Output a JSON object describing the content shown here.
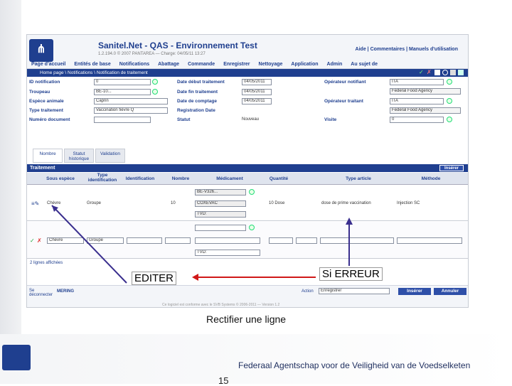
{
  "slide": {
    "caption": "Rectifier une ligne",
    "agency": "Federaal Agentschap voor de Veiligheid van de Voedselketen",
    "page_number": "15"
  },
  "app": {
    "title": "Sanitel.Net - QAS - Environnement Test",
    "subtitle": "1.2.194.0 © 2007 PANTAREA — Charge: 04/05/11 13:27",
    "top_links": "Aide | Commentaires | Manuels d'utilisation",
    "menu": [
      "Page d'accueil",
      "Entités de base",
      "Notifications",
      "Abattage",
      "Commande",
      "Enregistrer",
      "Nettoyage",
      "Application",
      "Admin",
      "Au sujet de"
    ],
    "breadcrumb": "Home page \\ Notifications \\ Notification de traitement"
  },
  "form": {
    "labels": {
      "id_notification": "ID notification",
      "troupeau": "Troupeau",
      "espece": "Espèce animale",
      "type_traitement": "Type traitement",
      "numero_document": "Numéro document",
      "date_debut": "Date début traitement",
      "date_fin": "Date fin traitement",
      "date_comptage": "Date de comptage",
      "registration_date": "Registration Date",
      "statut": "Statut",
      "operateur_notifiant": "Opérateur notifiant",
      "operateur_traitant": "Opérateur traitant",
      "visite": "Visite"
    },
    "values": {
      "id_notification": "0",
      "troupeau": "BE-10...",
      "espece": "Caprin",
      "type_traitement": "Vaccination fièvre Q",
      "date_debut": "04/05/2011",
      "date_fin": "04/05/2011",
      "date_comptage": "04/05/2011",
      "statut": "Nouveau",
      "operateur_notifiant": "ITA",
      "operateur_notifiant_name": "Federal Food Agency",
      "operateur_traitant": "ITA",
      "operateur_traitant_name": "Federal Food Agency",
      "visite": "0"
    }
  },
  "tabs": [
    "Nombre",
    "Statut historique",
    "Validation"
  ],
  "table": {
    "title": "Traitement",
    "insert_label": "Insérer",
    "columns": [
      "Sous espèce",
      "Type identification",
      "Identification",
      "Nombre",
      "Médicament",
      "Quantité",
      "Type article",
      "Méthode"
    ],
    "row1": {
      "sous_espece": "Chèvre",
      "type_id": "Groupe",
      "nombre": "10",
      "medicament_code": "BE-V326...",
      "medicament_name": "COXEVAC",
      "medicament_tvd": "TVD:",
      "quantite": "10 Dose",
      "type_article": "dose de prime vaccination",
      "methode": "Injection SC"
    },
    "edit_row": {
      "sous_espece": "Chèvre",
      "type_id": "Groupe",
      "tvd": "TVD:"
    },
    "count_text": "2 lignes affichées"
  },
  "bottom": {
    "disconnect": "Se déconnecter",
    "user": "MERING",
    "action_label": "Action",
    "action_value": "Enregistrer",
    "insert_button": "Insérer",
    "cancel_button": "Annuler",
    "footer_text": "Ce logiciel est conforme avec le SVB Systems © 2006-2011 — Version 1.2"
  },
  "annotations": {
    "editer": "EDITER",
    "si_erreur": "Si ERREUR"
  }
}
